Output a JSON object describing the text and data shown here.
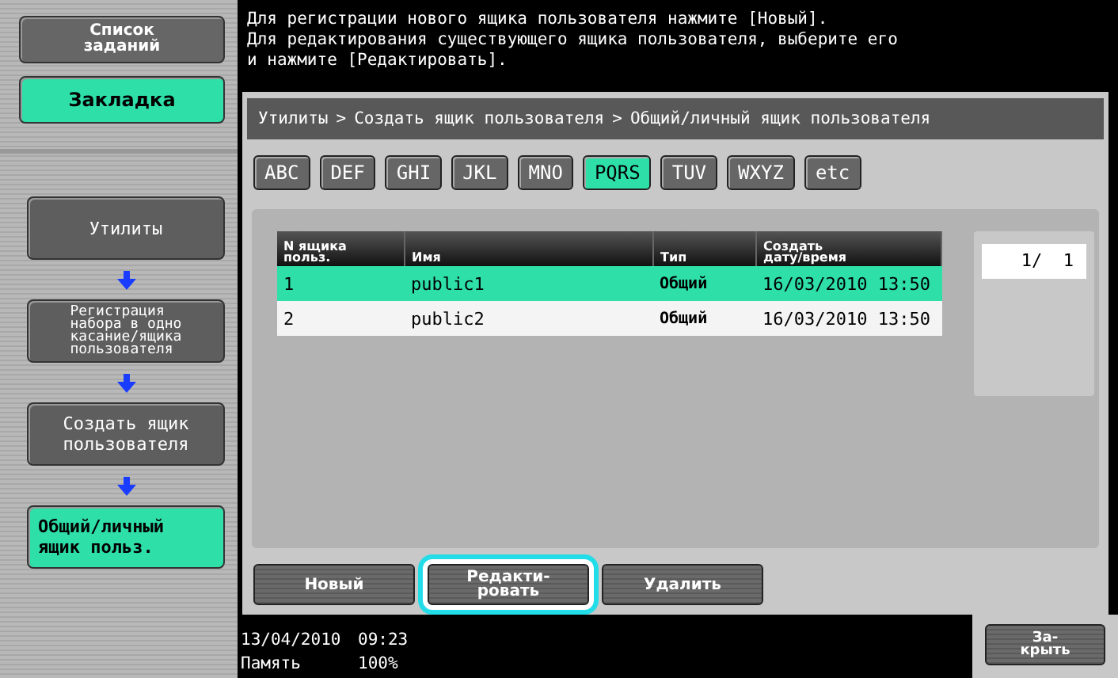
{
  "sidebar": {
    "top_buttons": [
      {
        "label": "Список\nзаданий",
        "selected": false
      },
      {
        "label": "Закладка",
        "selected": true
      }
    ],
    "steps": [
      {
        "label": "Утилиты",
        "selected": false,
        "small": false
      },
      {
        "label": "Регистрация\nнабора в одно\nкасание/ящика\nпользователя",
        "selected": false,
        "small": true
      },
      {
        "label": "Создать ящик\nпользователя",
        "selected": false,
        "small": false
      },
      {
        "label": "Общий/личный\nящик польз.",
        "selected": true,
        "small": false
      }
    ]
  },
  "message": "Для регистрации нового ящика пользователя нажмите [Новый].\nДля редактирования существующего ящика пользователя, выберите его\nи нажмите [Редактировать].",
  "breadcrumb": [
    "Утилиты",
    "Создать ящик пользователя",
    "Общий/личный ящик пользователя"
  ],
  "breadcrumb_separator": ">",
  "letter_tabs": [
    {
      "label": "ABC",
      "selected": false
    },
    {
      "label": "DEF",
      "selected": false
    },
    {
      "label": "GHI",
      "selected": false
    },
    {
      "label": "JKL",
      "selected": false
    },
    {
      "label": "MNO",
      "selected": false
    },
    {
      "label": "PQRS",
      "selected": true
    },
    {
      "label": "TUV",
      "selected": false
    },
    {
      "label": "WXYZ",
      "selected": false
    },
    {
      "label": "etc",
      "selected": false
    }
  ],
  "table": {
    "columns": [
      "N ящика\nпольз.",
      "Имя",
      "Тип",
      "Создать\nдату/время"
    ],
    "rows": [
      {
        "cells": [
          "1",
          "public1",
          "Общий",
          "16/03/2010 13:50"
        ],
        "selected": true
      },
      {
        "cells": [
          "2",
          "public2",
          "Общий",
          "16/03/2010 13:50"
        ],
        "selected": false
      }
    ]
  },
  "pager": "1/  1",
  "buttons": [
    {
      "label": "Новый",
      "highlighted": false
    },
    {
      "label": "Редакти-\nровать",
      "highlighted": true
    },
    {
      "label": "Удалить",
      "highlighted": false
    }
  ],
  "status_bar": {
    "date": "13/04/2010",
    "time": "09:23",
    "memory_label": "Память",
    "memory_value": "100%"
  },
  "close_button": "За-\nкрыть"
}
